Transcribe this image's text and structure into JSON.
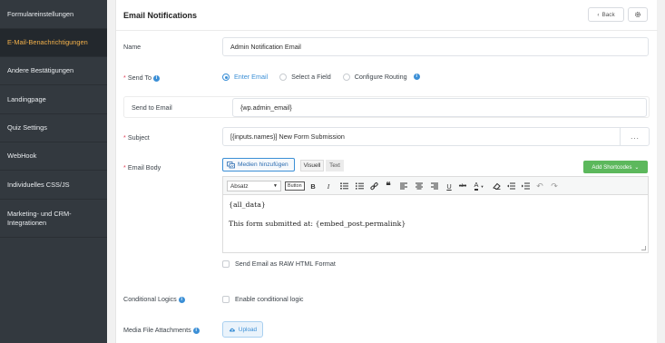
{
  "sidebar": {
    "items": [
      {
        "label": "Formulareinstellungen"
      },
      {
        "label": "E-Mail-Benachrichtigungen",
        "active": true
      },
      {
        "label": "Andere Bestätigungen"
      },
      {
        "label": "Landingpage"
      },
      {
        "label": "Quiz Settings"
      },
      {
        "label": "WebHook"
      },
      {
        "label": "Individuelles CSS/JS"
      },
      {
        "label": "Marketing- und CRM-",
        "label2": "Integrationen"
      }
    ]
  },
  "header": {
    "title": "Email Notifications",
    "back_label": "Back"
  },
  "form": {
    "name": {
      "label": "Name",
      "value": "Admin Notification Email"
    },
    "send_to": {
      "label": "Send To",
      "options": [
        "Enter Email",
        "Select a Field",
        "Configure Routing"
      ],
      "selected": "Enter Email"
    },
    "send_to_email": {
      "label": "Send to Email",
      "value": "{wp.admin_email}"
    },
    "subject": {
      "label": "Subject",
      "value": "[{inputs.names}] New Form Submission",
      "more_label": "..."
    },
    "email_body": {
      "label": "Email Body",
      "media_button": "Medien hinzufügen",
      "tab_visual": "Visuell",
      "tab_text": "Text",
      "shortcodes_button": "Add Shortcodes",
      "format_select": "Absatz",
      "toolbar_button_label": "Button",
      "content_line1": "{all_data}",
      "content_line2": "This form submitted at: {embed_post.permalink}"
    },
    "raw_html": {
      "label": "Send Email as RAW HTML Format"
    },
    "conditional": {
      "label": "Conditional Logics",
      "option": "Enable conditional logic"
    },
    "attachments": {
      "label": "Media File Attachments",
      "upload_label": "Upload"
    }
  },
  "colors": {
    "accent": "#3b8fd6",
    "sidebar_bg": "#33393f",
    "sidebar_active_text": "#f2b04a",
    "required": "#e2435b",
    "shortcodes_green": "#5cb85c"
  }
}
